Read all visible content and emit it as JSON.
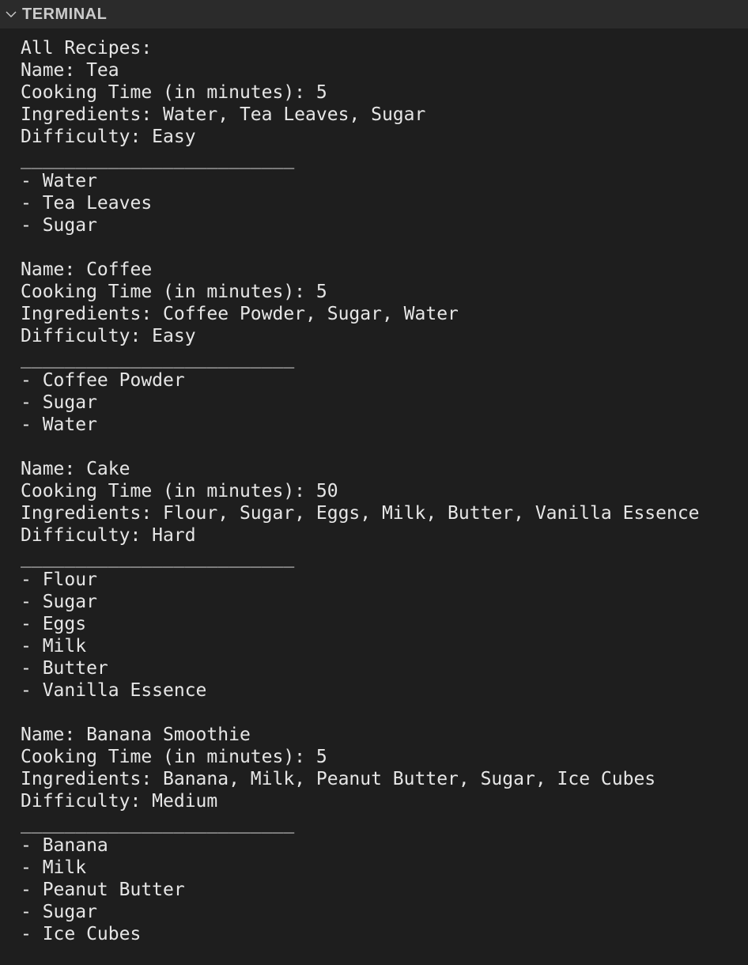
{
  "panel": {
    "title": "TERMINAL",
    "chevron_icon": "chevron-down-icon"
  },
  "terminal": {
    "lines": [
      "All Recipes:",
      "Name: Tea",
      "Cooking Time (in minutes): 5",
      "Ingredients: Water, Tea Leaves, Sugar",
      "Difficulty: Easy",
      "_________________________",
      "- Water",
      "- Tea Leaves",
      "- Sugar",
      "",
      "Name: Coffee",
      "Cooking Time (in minutes): 5",
      "Ingredients: Coffee Powder, Sugar, Water",
      "Difficulty: Easy",
      "_________________________",
      "- Coffee Powder",
      "- Sugar",
      "- Water",
      "",
      "Name: Cake",
      "Cooking Time (in minutes): 50",
      "Ingredients: Flour, Sugar, Eggs, Milk, Butter, Vanilla Essence",
      "Difficulty: Hard",
      "_________________________",
      "- Flour",
      "- Sugar",
      "- Eggs",
      "- Milk",
      "- Butter",
      "- Vanilla Essence",
      "",
      "Name: Banana Smoothie",
      "Cooking Time (in minutes): 5",
      "Ingredients: Banana, Milk, Peanut Butter, Sugar, Ice Cubes",
      "Difficulty: Medium",
      "_________________________",
      "- Banana",
      "- Milk",
      "- Peanut Butter",
      "- Sugar",
      "- Ice Cubes"
    ]
  }
}
